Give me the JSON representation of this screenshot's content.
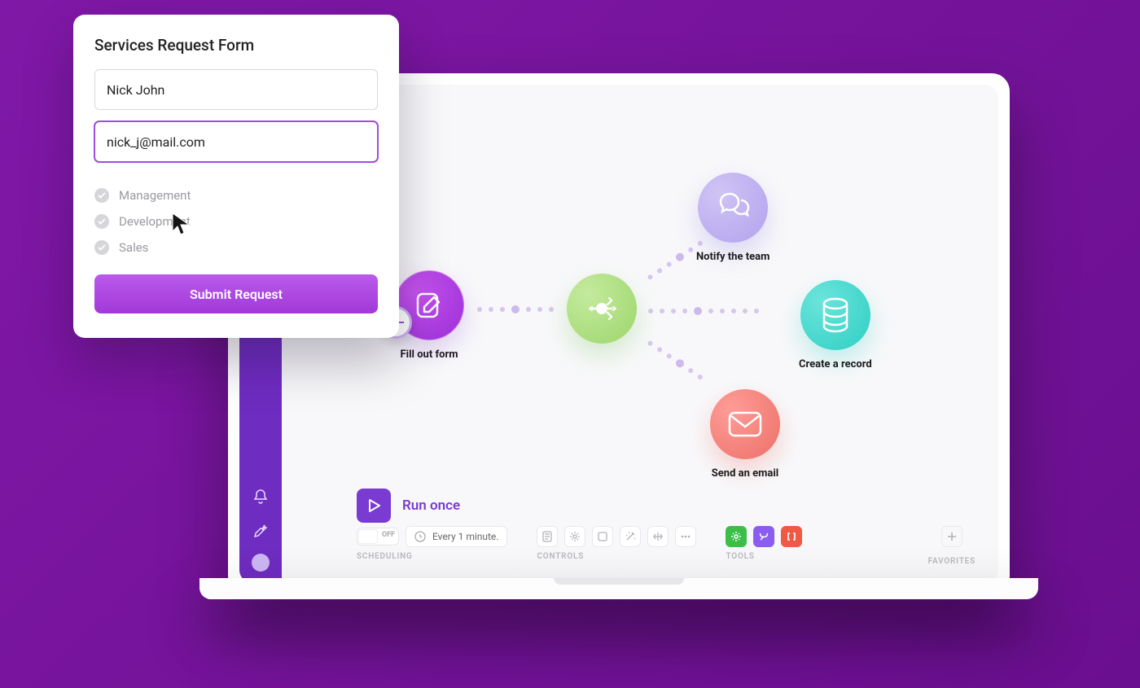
{
  "form": {
    "title": "Services Request Form",
    "name_value": "Nick John",
    "email_value": "nick_j@mail.com",
    "options": [
      "Management",
      "Development",
      "Sales"
    ],
    "submit_label": "Submit Request"
  },
  "flow": {
    "fill_out": "Fill out form",
    "notify": "Notify the team",
    "create_record": "Create a record",
    "send_email": "Send an email"
  },
  "runbar": {
    "run_once": "Run once"
  },
  "bottombar": {
    "toggle_state": "OFF",
    "schedule_text": "Every 1 minute.",
    "scheduling_cap": "SCHEDULING",
    "controls_cap": "CONTROLS",
    "tools_cap": "TOOLS",
    "favorites_cap": "FAVORITES"
  },
  "colors": {
    "accent": "#7a3bd2"
  }
}
